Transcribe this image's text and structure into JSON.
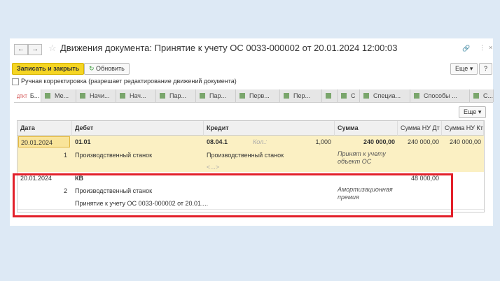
{
  "window": {
    "title": "Движения документа: Принятие к учету ОС 0033-000002 от 20.01.2024 12:00:03"
  },
  "toolbar": {
    "save_close": "Записать и закрыть",
    "refresh": "Обновить",
    "more": "Еще",
    "help": "?"
  },
  "manual": {
    "label": "Ручная корректировка (разрешает редактирование движений документа)",
    "checked": false
  },
  "tabs": [
    "Б...",
    "Ме...",
    "Начи...",
    "Нач...",
    "Пар...",
    "Пар...",
    "Перв...",
    "Пер...",
    "",
    "С",
    "Специа...",
    "Способы ...",
    "С..."
  ],
  "grid": {
    "more": "Еще",
    "columns": [
      "Дата",
      "Дебет",
      "Кредит",
      "Сумма",
      "Сумма НУ Дт",
      "Сумма НУ Кт"
    ],
    "rows": [
      {
        "date": "20.01.2024",
        "num": "1",
        "debit": "01.01",
        "debit_sub": "Производственный станок",
        "credit": "08.04.1",
        "qty_label": "Кол.:",
        "qty": "1,000",
        "credit_sub": "Производственный станок",
        "credit_sub2": "<...>",
        "sum": "240 000,00",
        "content": "Принят к учету объект ОС",
        "nu_dt": "240 000,00",
        "nu_kt": "240 000,00"
      },
      {
        "date": "20.01.2024",
        "num": "2",
        "debit": "КВ",
        "debit_sub": "Производственный станок",
        "debit_sub2": "Принятие к учету ОС 0033-000002 от 20.01....",
        "content": "Амортизационная премия",
        "nu_dt": "48 000,00"
      }
    ]
  }
}
